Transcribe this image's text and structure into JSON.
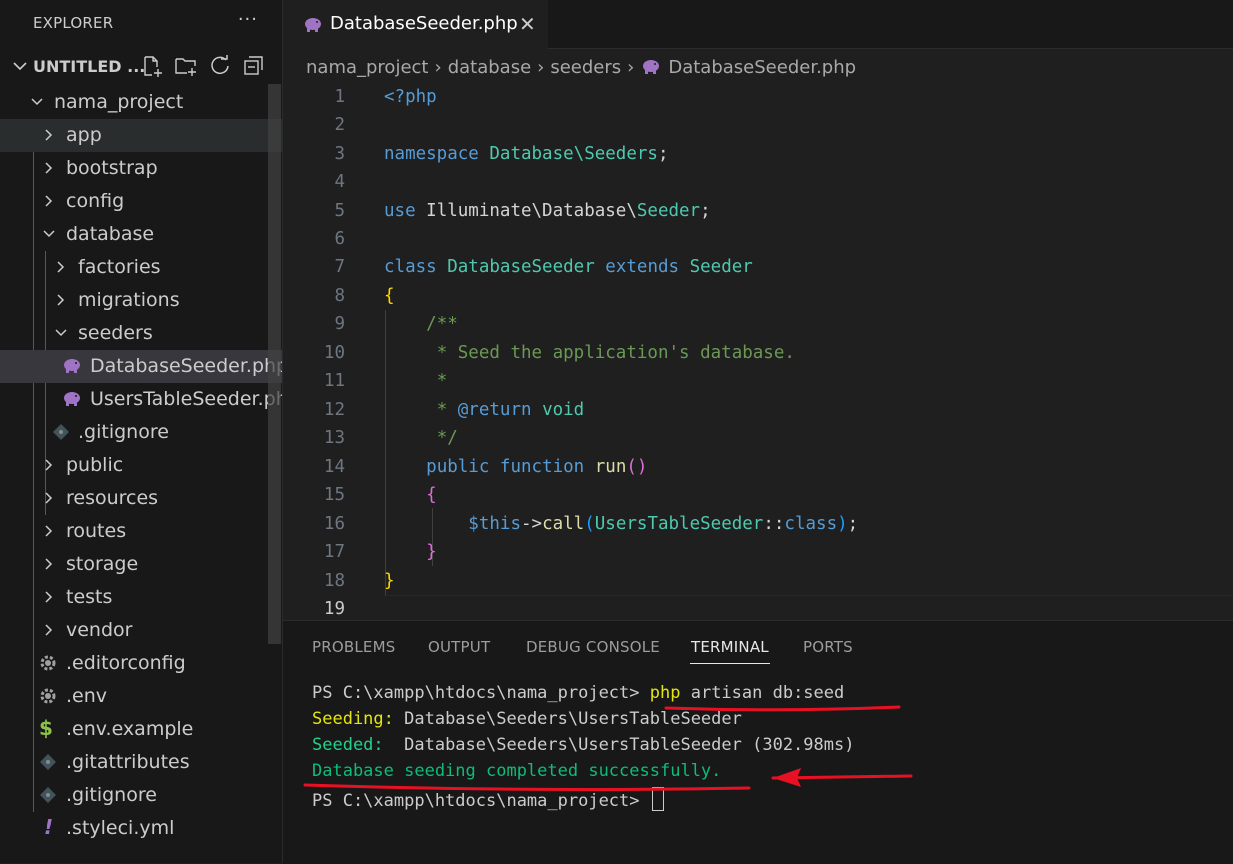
{
  "sidebar": {
    "title": "EXPLORER",
    "workspace": "UNTITLED ...",
    "tree": [
      {
        "label": "nama_project",
        "type": "folder-open"
      },
      {
        "label": "app",
        "type": "folder"
      },
      {
        "label": "bootstrap",
        "type": "folder"
      },
      {
        "label": "config",
        "type": "folder"
      },
      {
        "label": "database",
        "type": "folder-open"
      },
      {
        "label": "factories",
        "type": "folder"
      },
      {
        "label": "migrations",
        "type": "folder"
      },
      {
        "label": "seeders",
        "type": "folder-open"
      },
      {
        "label": "DatabaseSeeder.php",
        "type": "php"
      },
      {
        "label": "UsersTableSeeder.php",
        "type": "php"
      },
      {
        "label": ".gitignore",
        "type": "git"
      },
      {
        "label": "public",
        "type": "folder"
      },
      {
        "label": "resources",
        "type": "folder"
      },
      {
        "label": "routes",
        "type": "folder"
      },
      {
        "label": "storage",
        "type": "folder"
      },
      {
        "label": "tests",
        "type": "folder"
      },
      {
        "label": "vendor",
        "type": "folder"
      },
      {
        "label": ".editorconfig",
        "type": "gear"
      },
      {
        "label": ".env",
        "type": "gear"
      },
      {
        "label": ".env.example",
        "type": "dollar"
      },
      {
        "label": ".gitattributes",
        "type": "git"
      },
      {
        "label": ".gitignore",
        "type": "git"
      },
      {
        "label": ".styleci.yml",
        "type": "exclamation"
      }
    ]
  },
  "editor": {
    "tab_label": "DatabaseSeeder.php",
    "breadcrumb": [
      "nama_project",
      "database",
      "seeders",
      "DatabaseSeeder.php"
    ],
    "line_numbers": [
      "1",
      "2",
      "3",
      "4",
      "5",
      "6",
      "7",
      "8",
      "9",
      "10",
      "11",
      "12",
      "13",
      "14",
      "15",
      "16",
      "17",
      "18",
      "19"
    ],
    "code": {
      "l1": "<?php",
      "l3_kw": "namespace",
      "l3_ns": "Database\\Seeders",
      "l3_end": ";",
      "l5_kw": "use",
      "l5_path": "Illuminate\\Database\\",
      "l5_cls": "Seeder",
      "l5_end": ";",
      "l7_kw": "class",
      "l7_name": "DatabaseSeeder",
      "l7_ext": "extends",
      "l7_parent": "Seeder",
      "l8": "{",
      "l9": "/**",
      "l10": " * Seed the application's database.",
      "l11": " *",
      "l12_pre": " * ",
      "l12_tag": "@return",
      "l12_type": " void",
      "l13": " */",
      "l14_pub": "public",
      "l14_fn": "function",
      "l14_name": "run",
      "l14_paren": "()",
      "l15": "{",
      "l16_this": "$this",
      "l16_arrow": "->",
      "l16_call": "call",
      "l16_open": "(",
      "l16_cls": "UsersTableSeeder",
      "l16_sep": "::",
      "l16_class": "class",
      "l16_close": ")",
      "l16_end": ";",
      "l17": "}",
      "l18": "}"
    }
  },
  "panel": {
    "tabs": [
      "PROBLEMS",
      "OUTPUT",
      "DEBUG CONSOLE",
      "TERMINAL",
      "PORTS"
    ],
    "active_tab": "TERMINAL",
    "terminal": {
      "prompt1": "PS C:\\xampp\\htdocs\\nama_project> ",
      "cmd_php": "php",
      "cmd_rest": " artisan db:seed",
      "seeding_label": "Seeding:",
      "seeding_value": " Database\\Seeders\\UsersTableSeeder",
      "seeded_label": "Seeded:",
      "seeded_value": "  Database\\Seeders\\UsersTableSeeder (302.98ms)",
      "success": "Database seeding completed successfully.",
      "prompt2": "PS C:\\xampp\\htdocs\\nama_project> "
    }
  },
  "colors": {
    "annotation": "#e81123",
    "php_icon": "#a074c4"
  }
}
